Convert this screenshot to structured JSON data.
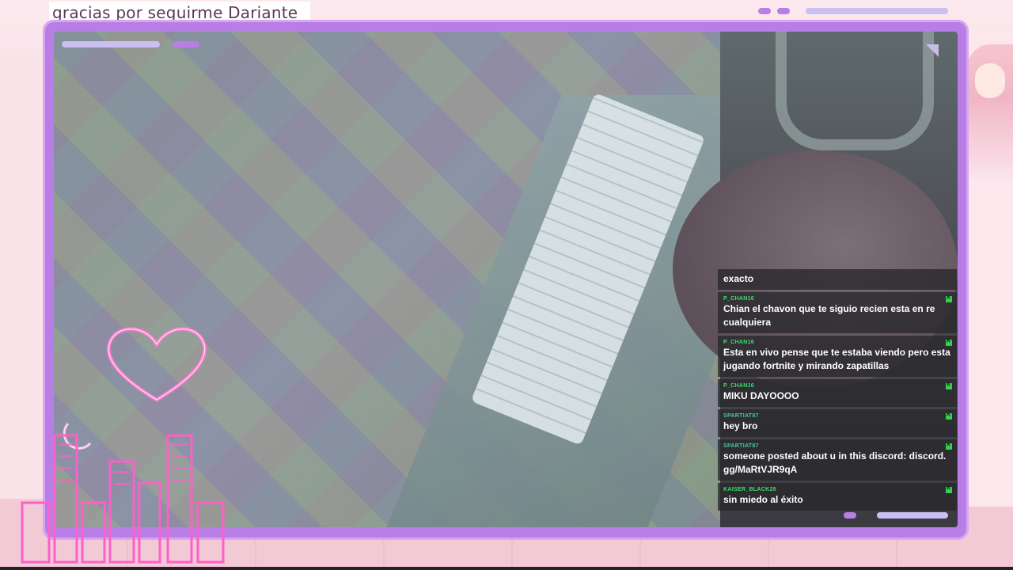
{
  "overlay": {
    "follow_banner": "gracias por seguirme Dariante_"
  },
  "chat": {
    "messages": [
      {
        "user": "",
        "text": "exacto",
        "badge": false
      },
      {
        "user": "P_CHAN16",
        "text": "Chian el chavon que te siguio recien esta en re cualquiera",
        "badge": true
      },
      {
        "user": "P_CHAN16",
        "text": "Esta en vivo pense que te estaba viendo pero esta jugando fortnite y mirando zapatillas",
        "badge": true
      },
      {
        "user": "P_CHAN16",
        "text": "MIKU DAYOOOO",
        "badge": true
      },
      {
        "user": "SPARTIAT87",
        "text": "hey bro",
        "badge": true
      },
      {
        "user": "SPARTIAT87",
        "text": "someone posted about u in this discord: discord. gg/MaRtVJR9qA",
        "badge": true
      },
      {
        "user": "KAISER_BLACK28",
        "text": "sin miedo al éxito",
        "badge": true
      }
    ]
  },
  "colors": {
    "frame": "#b97ee6",
    "neon_pink": "#ff5fc8",
    "username_green": "#3ddc6e",
    "badge_green": "#34d14f"
  },
  "icons": [
    "heart-neon-icon",
    "moon-neon-icon",
    "city-skyline-neon-icon",
    "moderator-badge-icon"
  ]
}
